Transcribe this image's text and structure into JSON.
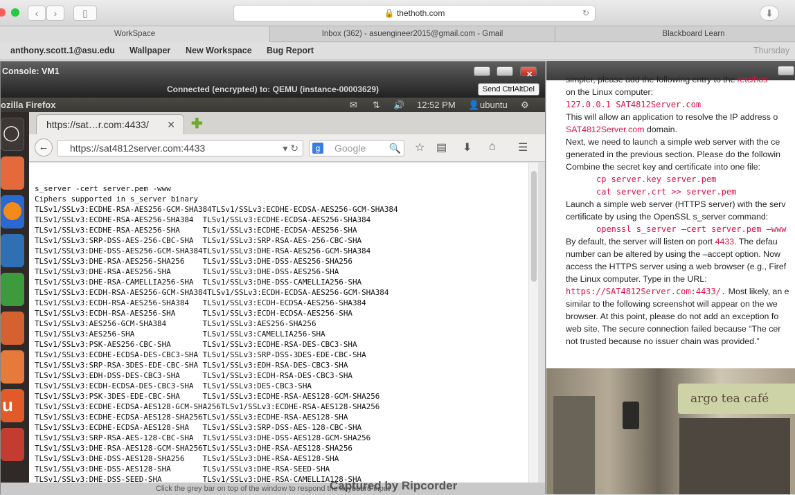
{
  "browser": {
    "url": "thethoth.com",
    "tabs": [
      {
        "label": "WorkSpace"
      },
      {
        "label": "Inbox (362) - asuengineer2015@gmail.com - Gmail"
      },
      {
        "label": "Blackboard Learn"
      }
    ],
    "bookmarks": [
      "anthony.scott.1@asu.edu",
      "Wallpaper",
      "New Workspace",
      "Bug Report"
    ],
    "bookmark_right": "Thursday"
  },
  "console": {
    "title": "Console: VM1",
    "connection": "Connected (encrypted) to: QEMU (instance-00003629)",
    "send_cad": "Send CtrlAltDel",
    "bottom_hint": "Click the grey bar on top of the window to respond the keyboard input"
  },
  "ubuntu": {
    "app_title": "ozilla Firefox",
    "time": "12:52 PM",
    "user": "ubuntu"
  },
  "firefox": {
    "tab_label": "https://sat…r.com:4433/",
    "url": "https://sat4812server.com:4433",
    "search_placeholder": "Google"
  },
  "terminal": {
    "lines": [
      "s_server -cert server.pem -www",
      "Ciphers supported in s_server binary",
      "TLSv1/SSLv3:ECDHE-RSA-AES256-GCM-SHA384TLSv1/SSLv3:ECDHE-ECDSA-AES256-GCM-SHA384",
      "TLSv1/SSLv3:ECDHE-RSA-AES256-SHA384  TLSv1/SSLv3:ECDHE-ECDSA-AES256-SHA384",
      "TLSv1/SSLv3:ECDHE-RSA-AES256-SHA     TLSv1/SSLv3:ECDHE-ECDSA-AES256-SHA",
      "TLSv1/SSLv3:SRP-DSS-AES-256-CBC-SHA  TLSv1/SSLv3:SRP-RSA-AES-256-CBC-SHA",
      "TLSv1/SSLv3:DHE-DSS-AES256-GCM-SHA384TLSv1/SSLv3:DHE-RSA-AES256-GCM-SHA384",
      "TLSv1/SSLv3:DHE-RSA-AES256-SHA256    TLSv1/SSLv3:DHE-DSS-AES256-SHA256",
      "TLSv1/SSLv3:DHE-RSA-AES256-SHA       TLSv1/SSLv3:DHE-DSS-AES256-SHA",
      "TLSv1/SSLv3:DHE-RSA-CAMELLIA256-SHA  TLSv1/SSLv3:DHE-DSS-CAMELLIA256-SHA",
      "TLSv1/SSLv3:ECDH-RSA-AES256-GCM-SHA384TLSv1/SSLv3:ECDH-ECDSA-AES256-GCM-SHA384",
      "TLSv1/SSLv3:ECDH-RSA-AES256-SHA384   TLSv1/SSLv3:ECDH-ECDSA-AES256-SHA384",
      "TLSv1/SSLv3:ECDH-RSA-AES256-SHA      TLSv1/SSLv3:ECDH-ECDSA-AES256-SHA",
      "TLSv1/SSLv3:AES256-GCM-SHA384        TLSv1/SSLv3:AES256-SHA256",
      "TLSv1/SSLv3:AES256-SHA               TLSv1/SSLv3:CAMELLIA256-SHA",
      "TLSv1/SSLv3:PSK-AES256-CBC-SHA       TLSv1/SSLv3:ECDHE-RSA-DES-CBC3-SHA",
      "TLSv1/SSLv3:ECDHE-ECDSA-DES-CBC3-SHA TLSv1/SSLv3:SRP-DSS-3DES-EDE-CBC-SHA",
      "TLSv1/SSLv3:SRP-RSA-3DES-EDE-CBC-SHA TLSv1/SSLv3:EDH-RSA-DES-CBC3-SHA",
      "TLSv1/SSLv3:EDH-DSS-DES-CBC3-SHA     TLSv1/SSLv3:ECDH-RSA-DES-CBC3-SHA",
      "TLSv1/SSLv3:ECDH-ECDSA-DES-CBC3-SHA  TLSv1/SSLv3:DES-CBC3-SHA",
      "TLSv1/SSLv3:PSK-3DES-EDE-CBC-SHA     TLSv1/SSLv3:ECDHE-RSA-AES128-GCM-SHA256",
      "TLSv1/SSLv3:ECDHE-ECDSA-AES128-GCM-SHA256TLSv1/SSLv3:ECDHE-RSA-AES128-SHA256",
      "TLSv1/SSLv3:ECDHE-ECDSA-AES128-SHA256TLSv1/SSLv3:ECDHE-RSA-AES128-SHA",
      "TLSv1/SSLv3:ECDHE-ECDSA-AES128-SHA   TLSv1/SSLv3:SRP-DSS-AES-128-CBC-SHA",
      "TLSv1/SSLv3:SRP-RSA-AES-128-CBC-SHA  TLSv1/SSLv3:DHE-DSS-AES128-GCM-SHA256",
      "TLSv1/SSLv3:DHE-RSA-AES128-GCM-SHA256TLSv1/SSLv3:DHE-RSA-AES128-SHA256",
      "TLSv1/SSLv3:DHE-DSS-AES128-SHA256    TLSv1/SSLv3:DHE-RSA-AES128-SHA",
      "TLSv1/SSLv3:DHE-DSS-AES128-SHA       TLSv1/SSLv3:DHE-RSA-SEED-SHA",
      "TLSv1/SSLv3:DHE-DSS-SEED-SHA         TLSv1/SSLv3:DHE-RSA-CAMELLIA128-SHA"
    ]
  },
  "doc": {
    "l1a": "simpler, please add the following entry to the ",
    "l1b": "/etc/hos",
    "l2": "on the Linux computer:",
    "c1": "127.0.0.1  SAT4812Server.com",
    "l3": "This will allow an application to resolve the IP address o",
    "l4a": "SAT4812Server.com",
    "l4b": " domain.",
    "l5": "Next, we need to launch a simple web server with the ce",
    "l6": "generated in the previous section. Please do the followin",
    "l7": "Combine the secret key and certificate into one file:",
    "c2": "cp server.key server.pem",
    "c3": "cat server.crt >> server.pem",
    "l8": "Launch a simple web server (HTTPS server) with the serv",
    "l9": "certificate by using the OpenSSL s_server command:",
    "c4": "openssl s_server –cert server.pem –www",
    "l10a": "By default, the server will listen on port ",
    "l10b": "4433",
    "l10c": ". The defau",
    "l11": "number can be altered by using the –accept option. Now",
    "l12": "access the HTTPS server using a web browser (e.g., Firef",
    "l13": "the Linux computer. Type in the URL:",
    "l14a": "https://SAT4812Server.com:4433/.",
    "l14b": " Most likely, an e",
    "l15": "similar to the following screenshot will appear on the we",
    "l16": "browser. At this point, please do not add an exception fo",
    "l17": "web site. The secure connection failed because “The cer",
    "l18": "not trusted because no issuer chain was provided.”"
  },
  "photo": {
    "sign": "argo tea café"
  },
  "watermark": "Captured by Ripcorder"
}
